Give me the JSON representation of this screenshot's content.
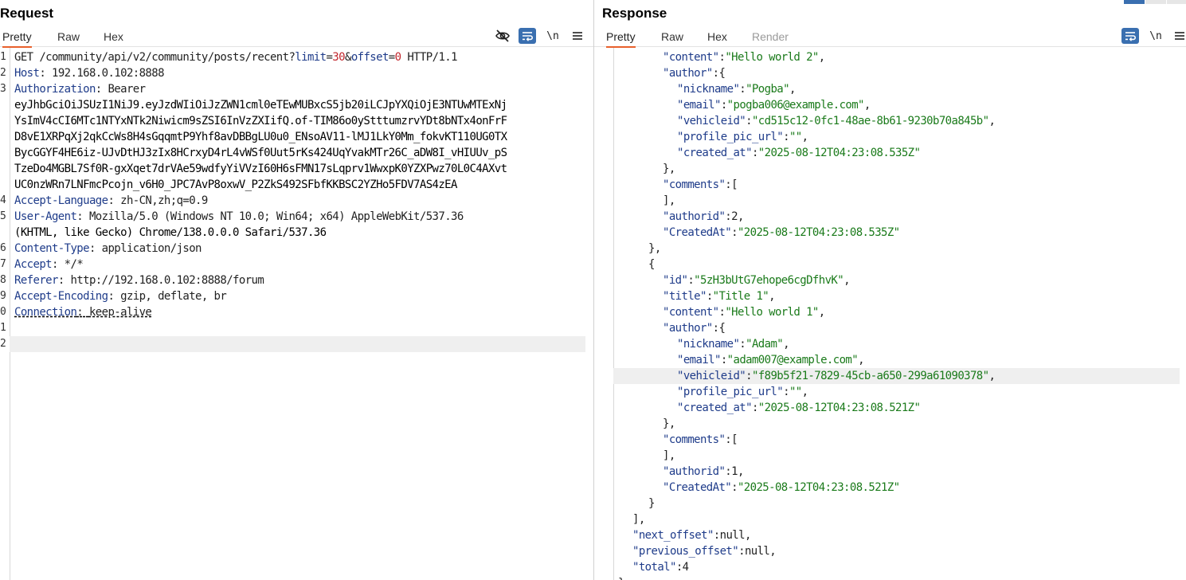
{
  "request": {
    "title": "Request",
    "tabs": [
      {
        "label": "Pretty"
      },
      {
        "label": "Raw"
      },
      {
        "label": "Hex"
      }
    ],
    "toolbar": {
      "newline_label": "\\n"
    },
    "line_numbers": [
      "1",
      "2",
      "3",
      "4",
      "5",
      "6",
      "7",
      "8",
      "9",
      "0",
      "1",
      "2"
    ],
    "lines": {
      "l1": {
        "method_path": "GET /community/api/v2/community/posts/recent?",
        "p1k": "limit",
        "eq1": "=",
        "p1v": "30",
        "amp": "&",
        "p2k": "offset",
        "eq2": "=",
        "p2v": "0",
        "proto": " HTTP/1.1"
      },
      "l2": {
        "key": "Host",
        "sep": ": ",
        "val": "192.168.0.102:8888"
      },
      "l3": {
        "key": "Authorization",
        "sep": ": ",
        "val": "Bearer"
      },
      "token": [
        "eyJhbGciOiJSUzI1NiJ9.eyJzdWIiOiJzZWN1cml0eTEwMUBxcS5jb20iLCJpYXQiOjE3NTUwMTExNj",
        "YsImV4cCI6MTc1NTYxNTk2Niwicm9sZSI6InVzZXIifQ.of-TIM86o0yStttumzrvYDt8bNTx4onFrF",
        "D8vE1XRPqXj2qkCcWs8H4sGqqmtP9Yhf8avDBBgLU0u0_ENsoAV11-lMJ1LkY0Mm_fokvKT110UG0TX",
        "BycGGYF4HE6iz-UJvDtHJ3zIx8HCrxyD4rL4vWSf0Uut5rKs424UqYvakMTr26C_aDW8I_vHIUUv_pS",
        "TzeDo4MGBL7Sf0R-gxXqet7drVAe59wdfyYiVVzI60H6sFMN17sLqprv1WwxpK0YZXPwz70L0C4AXvt",
        "UC0nzWRn7LNFmcPcojn_v6H0_JPC7AvP8oxwV_P2ZkS492SFbfKKBSC2YZHo5FDV7AS4zEA"
      ],
      "l4": {
        "key": "Accept-Language",
        "sep": ": ",
        "val": "zh-CN,zh;q=0.9"
      },
      "l5": {
        "key": "User-Agent",
        "sep": ": ",
        "val": "Mozilla/5.0 (Windows NT 10.0; Win64; x64) AppleWebKit/537.36",
        "cont": "(KHTML, like Gecko) Chrome/138.0.0.0 Safari/537.36"
      },
      "l6": {
        "key": "Content-Type",
        "sep": ": ",
        "val": "application/json"
      },
      "l7": {
        "key": "Accept",
        "sep": ": ",
        "val": "*/*"
      },
      "l8": {
        "key": "Referer",
        "sep": ": ",
        "val": "http://192.168.0.102:8888/forum"
      },
      "l9": {
        "key": "Accept-Encoding",
        "sep": ": ",
        "val": "gzip, deflate, br"
      },
      "l10": {
        "key": "Connection",
        "sep": ": ",
        "val": "keep-alive"
      }
    }
  },
  "response": {
    "title": "Response",
    "tabs": [
      {
        "label": "Pretty"
      },
      {
        "label": "Raw"
      },
      {
        "label": "Hex"
      },
      {
        "label": "Render"
      }
    ],
    "toolbar": {
      "newline_label": "\\n"
    },
    "json": {
      "post2": {
        "content": "\"Hello world 2\"",
        "nickname": "\"Pogba\"",
        "email": "\"pogba006@example.com\"",
        "vehicleid": "\"cd515c12-0fc1-48ae-8b61-9230b70a845b\"",
        "profile_pic_url": "\"\"",
        "created_at": "\"2025-08-12T04:23:08.535Z\"",
        "authorid": "2",
        "CreatedAt": "\"2025-08-12T04:23:08.535Z\""
      },
      "post1": {
        "id": "\"5zH3bUtG7ehope6cgDfhvK\"",
        "title": "\"Title 1\"",
        "content": "\"Hello world 1\"",
        "nickname": "\"Adam\"",
        "email": "\"adam007@example.com\"",
        "vehicleid": "\"f89b5f21-7829-45cb-a650-299a61090378\"",
        "profile_pic_url": "\"\"",
        "created_at": "\"2025-08-12T04:23:08.521Z\"",
        "authorid": "1",
        "CreatedAt": "\"2025-08-12T04:23:08.521Z\""
      },
      "next_offset": "null",
      "previous_offset": "null",
      "total": "4"
    }
  },
  "colors": {
    "accent": "#e8612c",
    "toggle_blue": "#3a6fb0",
    "key": "#1f3c8a",
    "string": "#1a7a1a",
    "param_value": "#c2272d"
  }
}
